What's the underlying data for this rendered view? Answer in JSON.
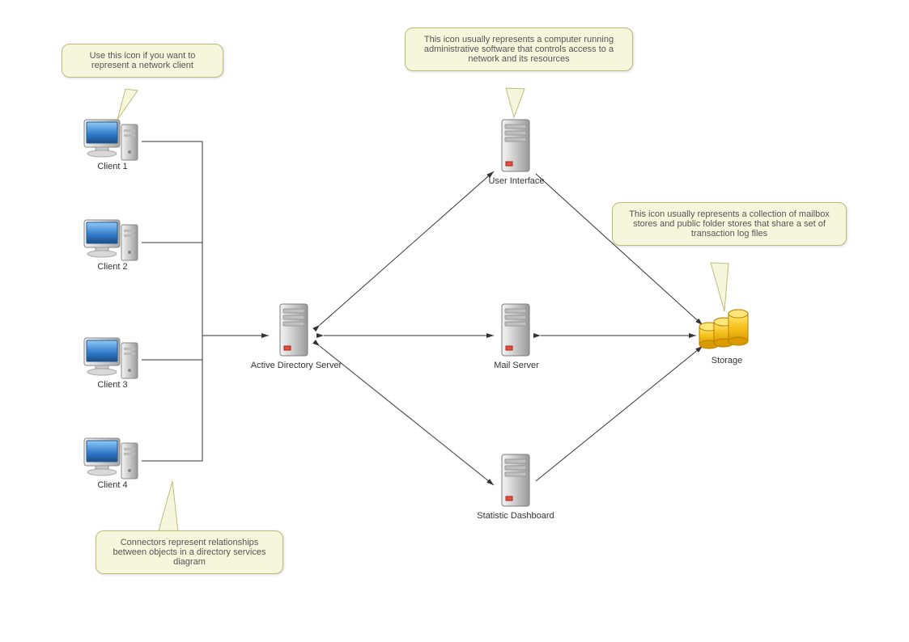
{
  "nodes": {
    "client1": {
      "label": "Client 1"
    },
    "client2": {
      "label": "Client 2"
    },
    "client3": {
      "label": "Client 3"
    },
    "client4": {
      "label": "Client 4"
    },
    "ad_server": {
      "label": "Active Directory Server"
    },
    "user_interface": {
      "label": "User Interface"
    },
    "mail_server": {
      "label": "Mail Server"
    },
    "statistic_dashboard": {
      "label": "Statistic Dashboard"
    },
    "storage": {
      "label": "Storage"
    }
  },
  "callouts": {
    "client_tip": "Use this icon if you want to represent a network client",
    "server_tip": "This icon usually represents a computer running administrative software that controls access to a network and its resources",
    "storage_tip": "This icon usually represents a collection of mailbox stores and public folder stores that share a set of transaction log files",
    "connector_tip": "Connectors represent relationships between objects in a directory services diagram"
  }
}
